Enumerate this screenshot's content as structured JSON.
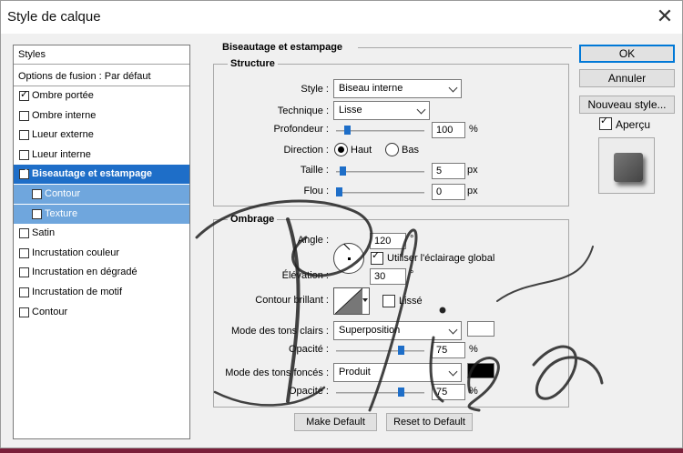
{
  "window": {
    "title": "Style de calque",
    "close_glyph": "✕"
  },
  "styles_panel": {
    "header": "Styles",
    "blend_options": "Options de fusion : Par défaut",
    "items": [
      {
        "label": "Ombre portée",
        "checked": true
      },
      {
        "label": "Ombre interne",
        "checked": false
      },
      {
        "label": "Lueur externe",
        "checked": false
      },
      {
        "label": "Lueur interne",
        "checked": false
      },
      {
        "label": "Biseautage et estampage",
        "checked": true,
        "selected": true
      },
      {
        "label": "Contour",
        "checked": false,
        "sub": true
      },
      {
        "label": "Texture",
        "checked": false,
        "sub": true
      },
      {
        "label": "Satin",
        "checked": false
      },
      {
        "label": "Incrustation couleur",
        "checked": false
      },
      {
        "label": "Incrustation en dégradé",
        "checked": false
      },
      {
        "label": "Incrustation de motif",
        "checked": false
      },
      {
        "label": "Contour",
        "checked": false
      }
    ]
  },
  "bevel": {
    "section_title": "Biseautage et estampage",
    "structure": {
      "title": "Structure",
      "style_label": "Style :",
      "style_value": "Biseau interne",
      "technique_label": "Technique :",
      "technique_value": "Lisse",
      "depth_label": "Profondeur :",
      "depth_value": "100",
      "depth_unit": "%",
      "depth_slider": 0.1,
      "direction_label": "Direction :",
      "direction_up": "Haut",
      "direction_down": "Bas",
      "direction_selected": "up",
      "size_label": "Taille :",
      "size_value": "5",
      "size_unit": "px",
      "size_slider": 0.04,
      "soften_label": "Flou :",
      "soften_value": "0",
      "soften_unit": "px",
      "soften_slider": 0.0
    },
    "shading": {
      "title": "Ombrage",
      "angle_label": "Angle :",
      "angle_value": "120",
      "angle_unit": "°",
      "global_light_label": "Utiliser l'éclairage global",
      "global_light_checked": true,
      "altitude_label": "Élévation :",
      "altitude_value": "30",
      "altitude_unit": "°",
      "gloss_label": "Contour brillant :",
      "antialias_label": "Lissé",
      "antialias_checked": false,
      "highlight_mode_label": "Mode des tons clairs :",
      "highlight_mode_value": "Superposition",
      "highlight_color": "#ffffff",
      "highlight_opacity_label": "Opacité :",
      "highlight_opacity_value": "75",
      "highlight_opacity_unit": "%",
      "highlight_opacity_slider": 0.75,
      "shadow_mode_label": "Mode des tons foncés :",
      "shadow_mode_value": "Produit",
      "shadow_color": "#000000",
      "shadow_opacity_label": "Opacité :",
      "shadow_opacity_value": "75",
      "shadow_opacity_unit": "%",
      "shadow_opacity_slider": 0.75
    },
    "make_default": "Make Default",
    "reset_default": "Reset to Default"
  },
  "buttons": {
    "ok": "OK",
    "cancel": "Annuler",
    "new_style": "Nouveau style...",
    "preview_label": "Aperçu",
    "preview_checked": true
  },
  "colors": {
    "accent": "#1e6ec8",
    "sub_selected": "#6fa6dd"
  }
}
